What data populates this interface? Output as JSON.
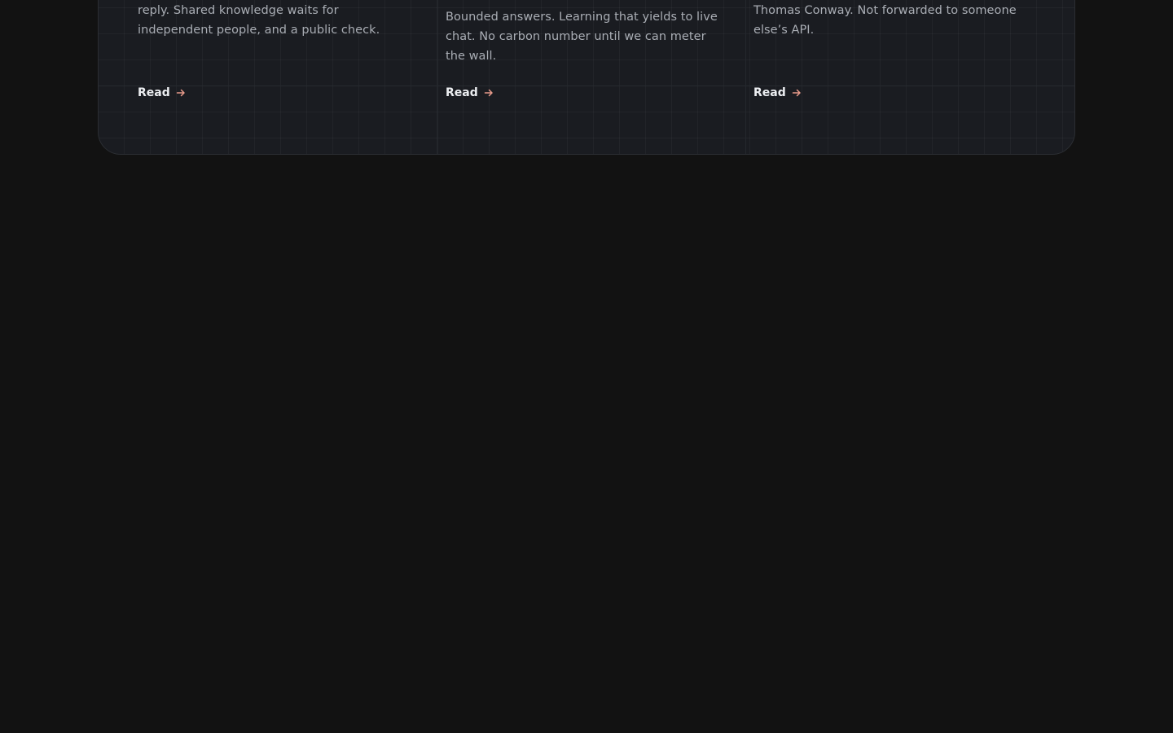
{
  "cards": [
    {
      "description": "reply. Shared knowledge waits for independent people, and a public check.",
      "link_label": "Read",
      "link_icon": "arrow-right-icon"
    },
    {
      "description": "Bounded answers. Learning that yields to live chat. No carbon number until we can meter the wall.",
      "link_label": "Read",
      "link_icon": "arrow-right-icon"
    },
    {
      "description": "Thomas Conway. Not forwarded to someone else’s API.",
      "link_label": "Read",
      "link_icon": "arrow-right-icon"
    }
  ],
  "colors": {
    "background": "#121212",
    "panel": "#1a1c21",
    "text": "#a9adb4",
    "link": "#eceef1",
    "arrow_accent": "#e79a8a"
  }
}
